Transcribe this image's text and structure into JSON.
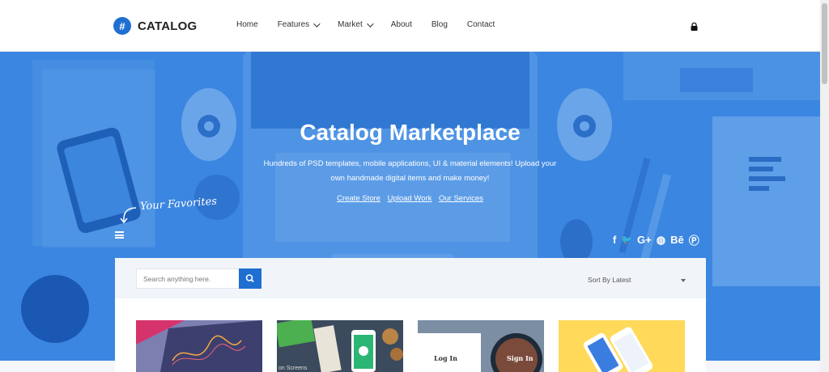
{
  "brand": {
    "badge": "#",
    "name": "CATALOG"
  },
  "nav": {
    "items": [
      {
        "label": "Home",
        "dropdown": false
      },
      {
        "label": "Features",
        "dropdown": true
      },
      {
        "label": "Market",
        "dropdown": true
      },
      {
        "label": "About",
        "dropdown": false
      },
      {
        "label": "Blog",
        "dropdown": false
      },
      {
        "label": "Contact",
        "dropdown": false
      }
    ]
  },
  "hero": {
    "title": "Catalog Marketplace",
    "subtitle": "Hundreds of PSD templates, mobile applications, UI & material elements! Upload your own handmade digital items and make money!",
    "links": [
      "Create Store",
      "Upload Work",
      "Our Services"
    ],
    "favorites": "Your Favorites",
    "social": [
      {
        "name": "facebook-icon",
        "glyph": "f"
      },
      {
        "name": "twitter-icon",
        "glyph": "🐦"
      },
      {
        "name": "google-plus-icon",
        "glyph": "G+"
      },
      {
        "name": "dribbble-icon",
        "glyph": "◍"
      },
      {
        "name": "behance-icon",
        "glyph": "Bē"
      },
      {
        "name": "pinterest-icon",
        "glyph": "Ⓟ"
      }
    ]
  },
  "search": {
    "placeholder": "Search anything here."
  },
  "sort": {
    "label": "Sort By Latest"
  },
  "cards": [
    {
      "caption": ""
    },
    {
      "caption": "on Screens"
    },
    {
      "caption": "Log In",
      "caption2": "Sign In"
    },
    {
      "caption": ""
    }
  ],
  "colors": {
    "accent": "#1f6fd1",
    "hero": "#3b86e0"
  }
}
